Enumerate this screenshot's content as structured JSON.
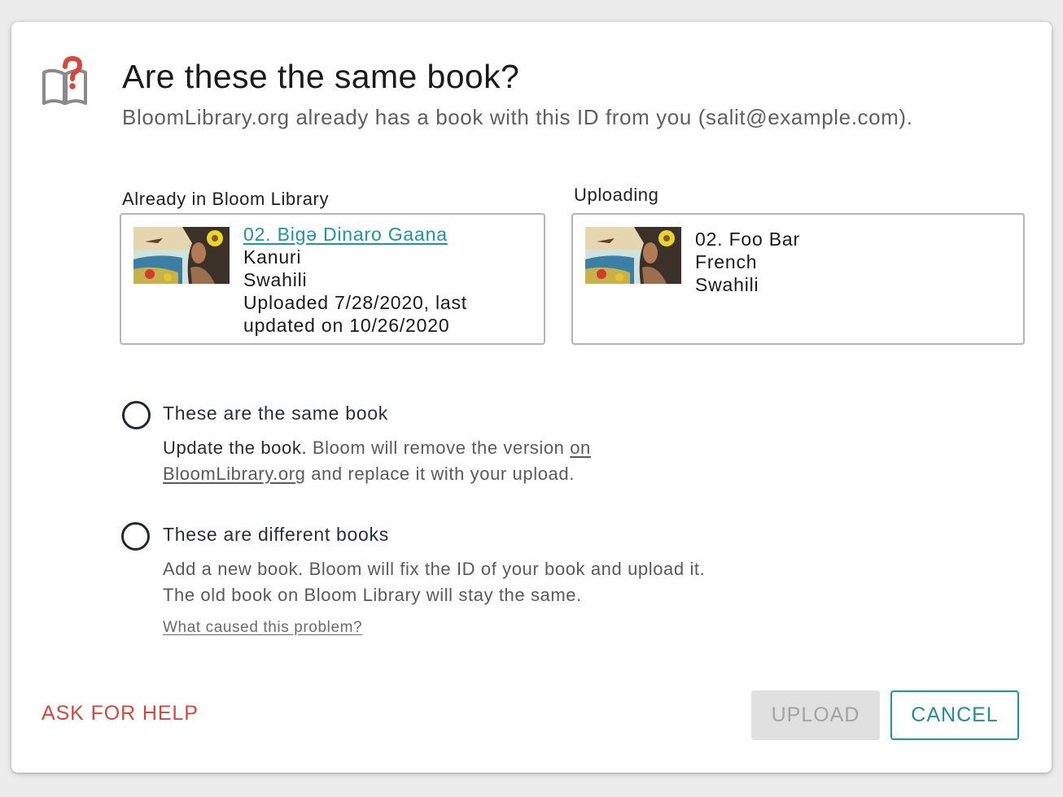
{
  "dialog": {
    "title": "Are these the same book?",
    "subtitle": "BloomLibrary.org already has a book with this ID from you (salit@example.com).",
    "icon": "book-question-icon"
  },
  "existing_book": {
    "label": "Already in Bloom Library",
    "title": "02. Bigə Dinaro Gaana",
    "language1": "Kanuri",
    "language2": "Swahili",
    "uploaded_line1": "Uploaded 7/28/2020, last",
    "uploaded_line2": "updated on 10/26/2020"
  },
  "uploading_book": {
    "label": "Uploading",
    "title": "02. Foo Bar",
    "language1": "French",
    "language2": "Swahili"
  },
  "options": {
    "same": {
      "title": "These are the same book",
      "desc_strong": "Update the book.",
      "desc_before_link": " Bloom will remove the version ",
      "desc_link": "on BloomLibrary.org",
      "desc_after_link": " and replace it with your upload."
    },
    "different": {
      "title": "These are different books",
      "desc": "Add a new book. Bloom will fix the ID of your book and upload it. The old book on Bloom Library will stay the same.",
      "link": "What caused this problem?"
    }
  },
  "buttons": {
    "help": "ASK FOR HELP",
    "upload": "UPLOAD",
    "cancel": "CANCEL"
  },
  "colors": {
    "accent": "#1d94a4",
    "help": "#cf4a3c",
    "icon_question": "#d9473c",
    "icon_book": "#8a8a8a"
  }
}
